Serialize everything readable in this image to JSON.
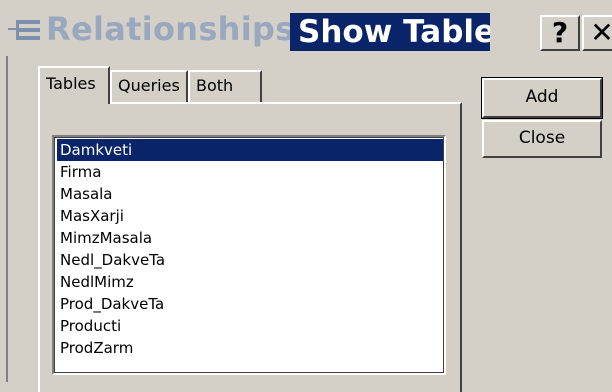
{
  "titlebar": {
    "background_title": "Relationships",
    "dialog_title": "Show Table",
    "help_label": "?",
    "close_label": "✕"
  },
  "tabs": [
    {
      "label": "Tables",
      "active": true
    },
    {
      "label": "Queries",
      "active": false
    },
    {
      "label": "Both",
      "active": false
    }
  ],
  "list": {
    "items": [
      "Damkveti",
      "Firma",
      "Masala",
      "MasXarji",
      "MimzMasala",
      "Nedl_DakveTa",
      "NedlMimz",
      "Prod_DakveTa",
      "Producti",
      "ProdZarm"
    ],
    "selected": "Damkveti"
  },
  "buttons": {
    "add_label": "Add",
    "close_label": "Close"
  },
  "colors": {
    "face": "#d4d0c8",
    "active_title": "#0a246a",
    "inactive_title_text": "#9aa8bf",
    "selection": "#0a246a"
  }
}
